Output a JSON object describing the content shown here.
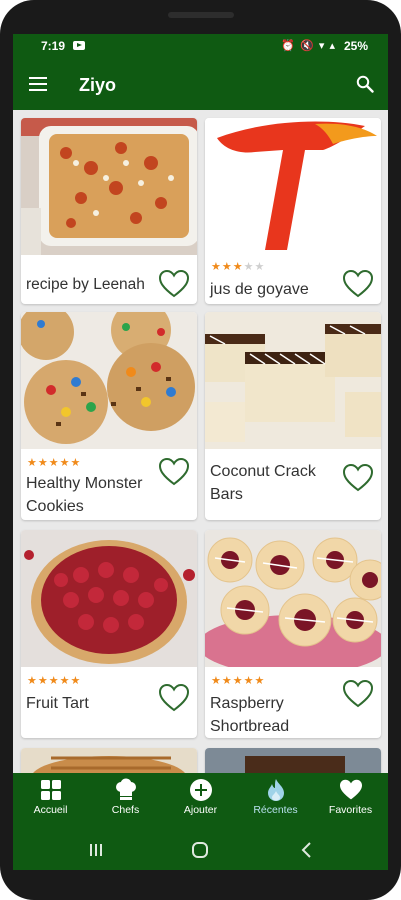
{
  "status_bar": {
    "time": "7:19",
    "icons": "⏰ 🔇 ▾ ▴",
    "battery": "25%"
  },
  "app_bar": {
    "title": "Ziyo",
    "menu_icon": "hamburger-menu-icon",
    "search_icon": "search-icon"
  },
  "recipes": [
    {
      "title": "recipe by Leenah",
      "rating": 0,
      "favorite": false
    },
    {
      "title": "jus de goyave",
      "rating": 3,
      "favorite": false
    },
    {
      "title": "Healthy Monster Cookies",
      "rating": 5,
      "favorite": false
    },
    {
      "title": "Coconut Crack Bars",
      "rating": 0,
      "favorite": false
    },
    {
      "title": "Fruit Tart",
      "rating": 5,
      "favorite": false
    },
    {
      "title": "Raspberry Shortbread",
      "rating": 5,
      "favorite": false
    }
  ],
  "bottom_nav": [
    {
      "label": "Accueil",
      "icon": "grid-icon"
    },
    {
      "label": "Chefs",
      "icon": "chef-hat-icon"
    },
    {
      "label": "Ajouter",
      "icon": "plus-circle-icon"
    },
    {
      "label": "Récentes",
      "icon": "flame-icon"
    },
    {
      "label": "Favorites",
      "icon": "heart-icon"
    }
  ],
  "colors": {
    "primary": "#0f5a12",
    "star": "#f08a1a",
    "heart_outline": "#2f6b2f"
  }
}
